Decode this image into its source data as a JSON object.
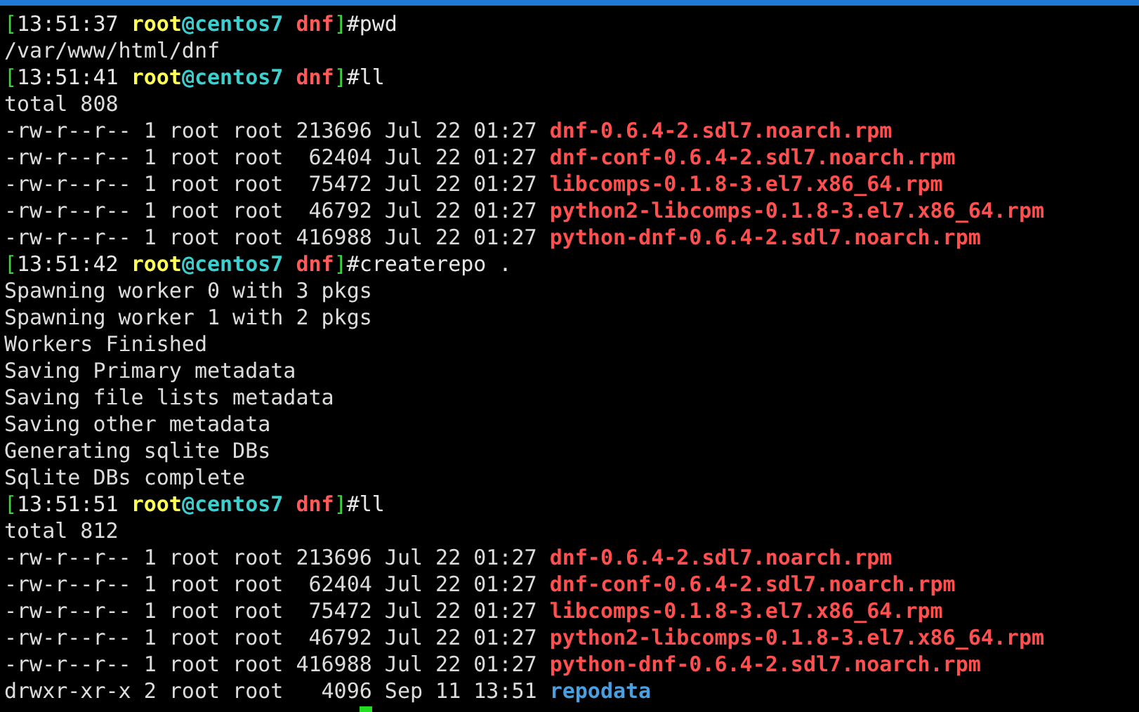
{
  "terminal": {
    "lines": [
      [
        {
          "kind": "bracket",
          "text": "["
        },
        {
          "kind": "time",
          "text": "13:51:37 "
        },
        {
          "kind": "user",
          "text": "root"
        },
        {
          "kind": "host",
          "text": "@centos7 "
        },
        {
          "kind": "dir",
          "text": "dnf"
        },
        {
          "kind": "bracket",
          "text": "]"
        },
        {
          "kind": "command",
          "text": "#pwd"
        }
      ],
      [
        {
          "kind": "plain",
          "text": "/var/www/html/dnf"
        }
      ],
      [
        {
          "kind": "bracket",
          "text": "["
        },
        {
          "kind": "time",
          "text": "13:51:41 "
        },
        {
          "kind": "user",
          "text": "root"
        },
        {
          "kind": "host",
          "text": "@centos7 "
        },
        {
          "kind": "dir",
          "text": "dnf"
        },
        {
          "kind": "bracket",
          "text": "]"
        },
        {
          "kind": "command",
          "text": "#ll"
        }
      ],
      [
        {
          "kind": "plain",
          "text": "total 808"
        }
      ],
      [
        {
          "kind": "plain",
          "text": "-rw-r--r-- 1 root root 213696 Jul 22 01:27 "
        },
        {
          "kind": "rpm",
          "text": "dnf-0.6.4-2.sdl7.noarch.rpm"
        }
      ],
      [
        {
          "kind": "plain",
          "text": "-rw-r--r-- 1 root root  62404 Jul 22 01:27 "
        },
        {
          "kind": "rpm",
          "text": "dnf-conf-0.6.4-2.sdl7.noarch.rpm"
        }
      ],
      [
        {
          "kind": "plain",
          "text": "-rw-r--r-- 1 root root  75472 Jul 22 01:27 "
        },
        {
          "kind": "rpm",
          "text": "libcomps-0.1.8-3.el7.x86_64.rpm"
        }
      ],
      [
        {
          "kind": "plain",
          "text": "-rw-r--r-- 1 root root  46792 Jul 22 01:27 "
        },
        {
          "kind": "rpm",
          "text": "python2-libcomps-0.1.8-3.el7.x86_64.rpm"
        }
      ],
      [
        {
          "kind": "plain",
          "text": "-rw-r--r-- 1 root root 416988 Jul 22 01:27 "
        },
        {
          "kind": "rpm",
          "text": "python-dnf-0.6.4-2.sdl7.noarch.rpm"
        }
      ],
      [
        {
          "kind": "bracket",
          "text": "["
        },
        {
          "kind": "time",
          "text": "13:51:42 "
        },
        {
          "kind": "user",
          "text": "root"
        },
        {
          "kind": "host",
          "text": "@centos7 "
        },
        {
          "kind": "dir",
          "text": "dnf"
        },
        {
          "kind": "bracket",
          "text": "]"
        },
        {
          "kind": "command",
          "text": "#createrepo ."
        }
      ],
      [
        {
          "kind": "plain",
          "text": "Spawning worker 0 with 3 pkgs"
        }
      ],
      [
        {
          "kind": "plain",
          "text": "Spawning worker 1 with 2 pkgs"
        }
      ],
      [
        {
          "kind": "plain",
          "text": "Workers Finished"
        }
      ],
      [
        {
          "kind": "plain",
          "text": "Saving Primary metadata"
        }
      ],
      [
        {
          "kind": "plain",
          "text": "Saving file lists metadata"
        }
      ],
      [
        {
          "kind": "plain",
          "text": "Saving other metadata"
        }
      ],
      [
        {
          "kind": "plain",
          "text": "Generating sqlite DBs"
        }
      ],
      [
        {
          "kind": "plain",
          "text": "Sqlite DBs complete"
        }
      ],
      [
        {
          "kind": "bracket",
          "text": "["
        },
        {
          "kind": "time",
          "text": "13:51:51 "
        },
        {
          "kind": "user",
          "text": "root"
        },
        {
          "kind": "host",
          "text": "@centos7 "
        },
        {
          "kind": "dir",
          "text": "dnf"
        },
        {
          "kind": "bracket",
          "text": "]"
        },
        {
          "kind": "command",
          "text": "#ll"
        }
      ],
      [
        {
          "kind": "plain",
          "text": "total 812"
        }
      ],
      [
        {
          "kind": "plain",
          "text": "-rw-r--r-- 1 root root 213696 Jul 22 01:27 "
        },
        {
          "kind": "rpm",
          "text": "dnf-0.6.4-2.sdl7.noarch.rpm"
        }
      ],
      [
        {
          "kind": "plain",
          "text": "-rw-r--r-- 1 root root  62404 Jul 22 01:27 "
        },
        {
          "kind": "rpm",
          "text": "dnf-conf-0.6.4-2.sdl7.noarch.rpm"
        }
      ],
      [
        {
          "kind": "plain",
          "text": "-rw-r--r-- 1 root root  75472 Jul 22 01:27 "
        },
        {
          "kind": "rpm",
          "text": "libcomps-0.1.8-3.el7.x86_64.rpm"
        }
      ],
      [
        {
          "kind": "plain",
          "text": "-rw-r--r-- 1 root root  46792 Jul 22 01:27 "
        },
        {
          "kind": "rpm",
          "text": "python2-libcomps-0.1.8-3.el7.x86_64.rpm"
        }
      ],
      [
        {
          "kind": "plain",
          "text": "-rw-r--r-- 1 root root 416988 Jul 22 01:27 "
        },
        {
          "kind": "rpm",
          "text": "python-dnf-0.6.4-2.sdl7.noarch.rpm"
        }
      ],
      [
        {
          "kind": "plain",
          "text": "drwxr-xr-x 2 root root   4096 Sep 11 13:51 "
        },
        {
          "kind": "directory",
          "text": "repodata"
        }
      ]
    ]
  }
}
